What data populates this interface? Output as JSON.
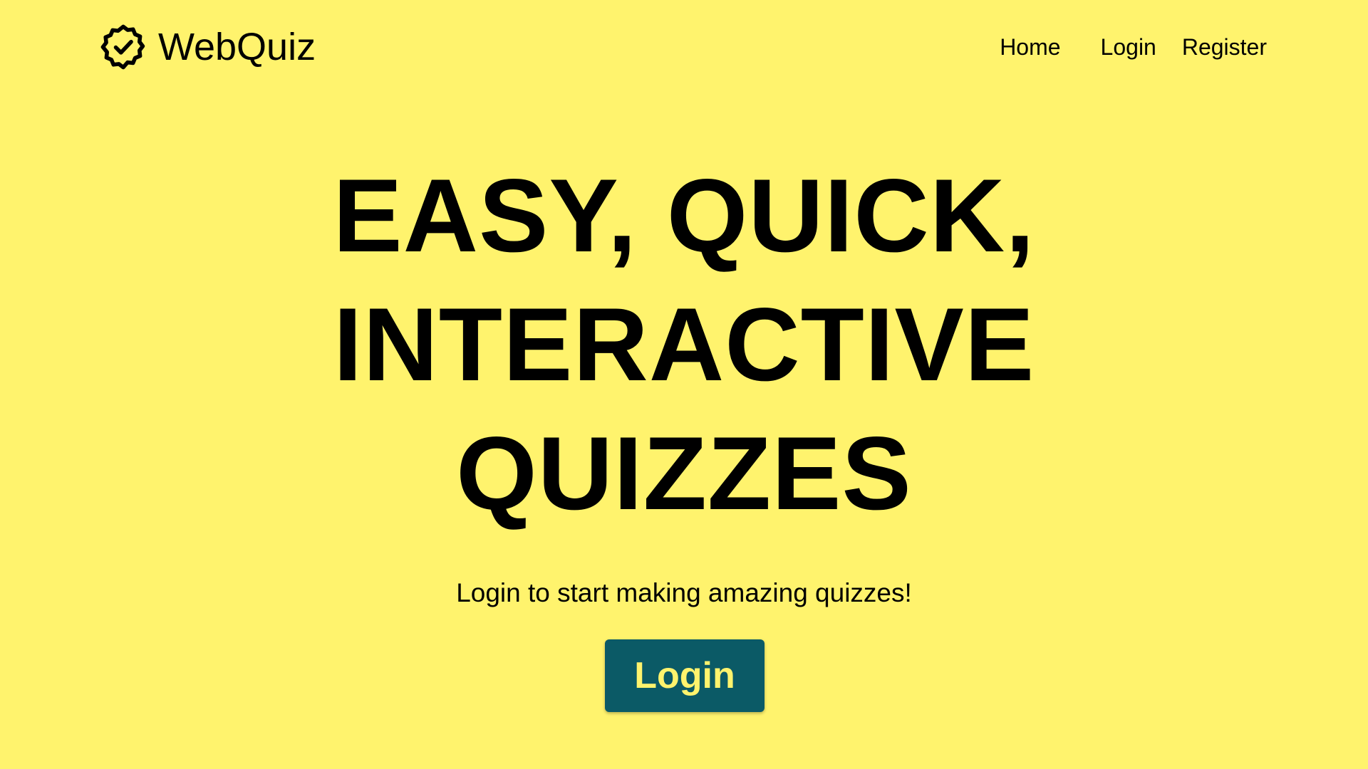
{
  "colors": {
    "background": "#fff36d",
    "text": "#000000",
    "button_background": "#0b5a66",
    "button_text": "#fff36d"
  },
  "brand": {
    "icon": "badge-check-icon",
    "name": "WebQuiz"
  },
  "nav": {
    "items": [
      {
        "label": "Home"
      },
      {
        "label": "Login"
      },
      {
        "label": "Register"
      }
    ]
  },
  "hero": {
    "lines": [
      "EASY, QUICK,",
      "INTERACTIVE",
      "QUIZZES"
    ],
    "subtitle": "Login to start making amazing quizzes!",
    "cta_label": "Login"
  }
}
